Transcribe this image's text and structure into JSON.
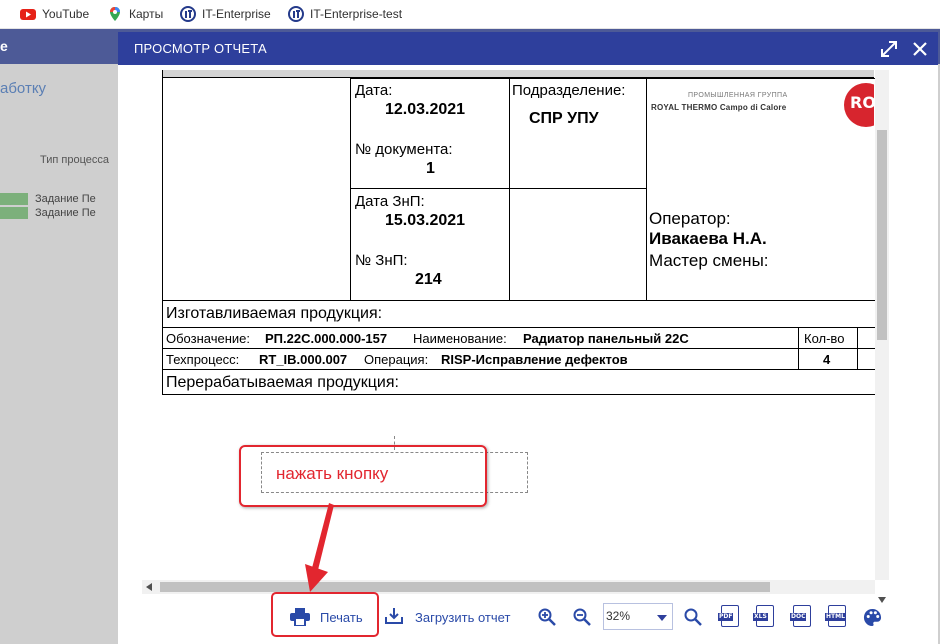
{
  "bookmarks": [
    {
      "label": "YouTube",
      "icon": "youtube-icon"
    },
    {
      "label": "Карты",
      "icon": "maps-pin-icon"
    },
    {
      "label": "IT-Enterprise",
      "icon": "it-logo-icon"
    },
    {
      "label": "IT-Enterprise-test",
      "icon": "it-logo-icon"
    }
  ],
  "background": {
    "header_fragment": "e",
    "link_fragment": "аботку",
    "column_header": "Тип процесса",
    "rows": [
      "Задание Пе",
      "Задание Пе"
    ]
  },
  "modal": {
    "title": "ПРОСМОТР ОТЧЕТА"
  },
  "report": {
    "date_label": "Дата:",
    "date": "12.03.2021",
    "doc_no_label": "№ документа:",
    "doc_no": "1",
    "znp_date_label": "Дата ЗнП:",
    "znp_date": "15.03.2021",
    "znp_no_label": "№ ЗнП:",
    "znp_no": "214",
    "division_label": "Подразделение:",
    "division": "СПР УПУ",
    "logo_line1": "ПРОМЫШЛЕННАЯ ГРУППА",
    "logo_line2": "ROYAL THERMO Campo di Calore",
    "operator_label": "Оператор:",
    "operator": "Ивакаева Н.А.",
    "master_label": "Мастер смены:",
    "produced_label": "Изготавливаемая продукция:",
    "designation_label": "Обозначение:",
    "designation": "РП.22С.000.000-157",
    "name_label": "Наименование:",
    "name": "Радиатор панельный 22С",
    "qty_label": "Кол-во",
    "techprocess_label": "Техпроцесс:",
    "techprocess": "RT_IB.000.007",
    "operation_label": "Операция:",
    "operation": "RISP-Исправление дефектов",
    "qty": "4",
    "processed_label": "Перерабатываемая продукция:"
  },
  "annotation": {
    "callout_text": "нажать кнопку"
  },
  "toolbar": {
    "print_label": "Печать",
    "download_label": "Загрузить отчет",
    "zoom_value": "32%",
    "formats": [
      "PDF",
      "XLS",
      "DOC",
      "HTML"
    ]
  },
  "colors": {
    "modal_header": "#2e3f9c",
    "accent_red": "#e2262f",
    "toolbar_icon": "#2a4aa8"
  }
}
